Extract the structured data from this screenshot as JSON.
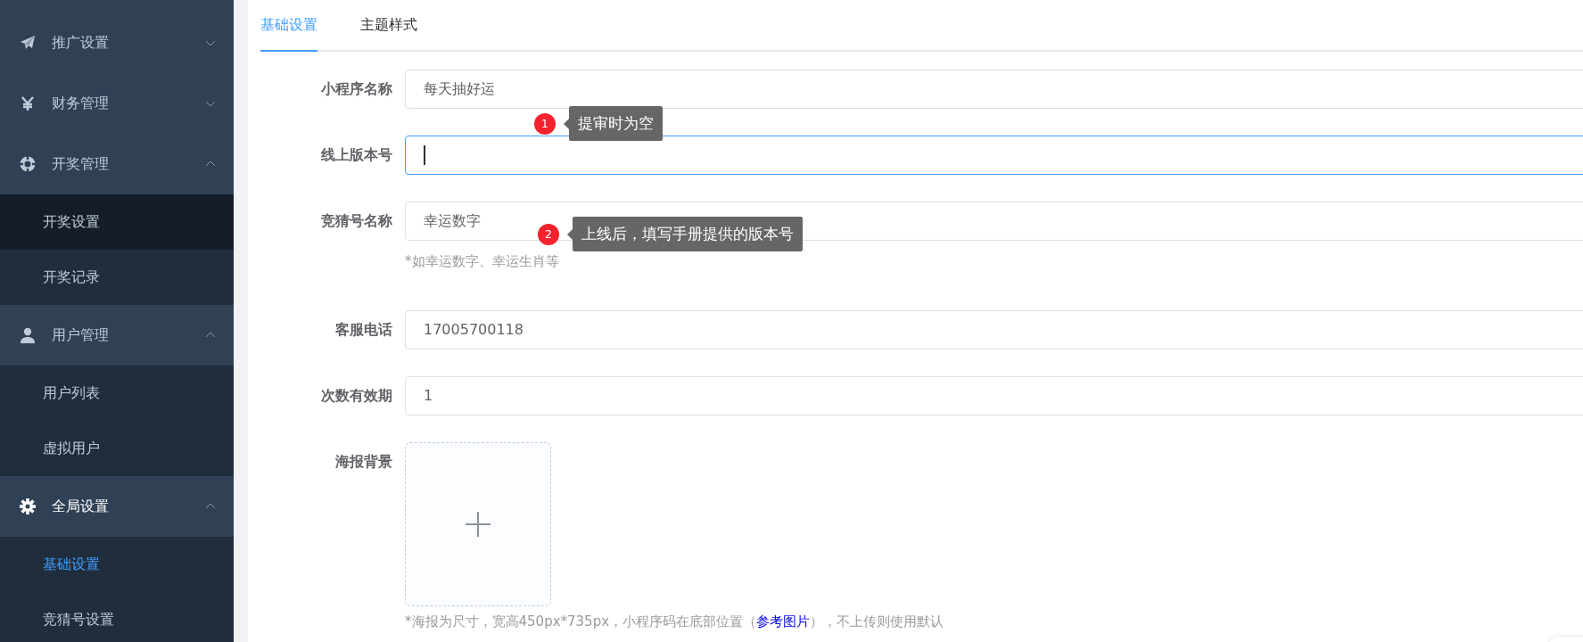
{
  "sidebar": {
    "groups": [
      {
        "label": "推广设置",
        "expanded": false
      },
      {
        "label": "财务管理",
        "expanded": false
      },
      {
        "label": "开奖管理",
        "expanded": true,
        "items": [
          {
            "label": "开奖设置",
            "selected": false,
            "hovered": true
          },
          {
            "label": "开奖记录",
            "selected": false,
            "hovered": false
          }
        ]
      },
      {
        "label": "用户管理",
        "expanded": true,
        "items": [
          {
            "label": "用户列表",
            "selected": false,
            "hovered": false
          },
          {
            "label": "虚拟用户",
            "selected": false,
            "hovered": false
          }
        ]
      },
      {
        "label": "全局设置",
        "expanded": true,
        "items": [
          {
            "label": "基础设置",
            "selected": true,
            "hovered": false
          },
          {
            "label": "竞猜号设置",
            "selected": false,
            "hovered": false
          }
        ]
      }
    ]
  },
  "tabs": [
    {
      "label": "基础设置",
      "selected": true
    },
    {
      "label": "主题样式",
      "selected": false
    }
  ],
  "form": {
    "fields": [
      {
        "kind": "text",
        "label": "小程序名称",
        "value": "每天抽好运",
        "focused": false
      },
      {
        "kind": "text",
        "label": "线上版本号",
        "focused": true
      },
      {
        "kind": "text",
        "label": "竞猜号名称",
        "value": "幸运数字",
        "focused": false,
        "hint": "*如幸运数字、幸运生肖等"
      },
      {
        "kind": "text",
        "label": "客服电话",
        "value": "17005700118",
        "focused": false
      },
      {
        "kind": "text",
        "label": "次数有效期",
        "value": "1",
        "focused": false
      },
      {
        "kind": "upload",
        "label": "海报背景",
        "hint_before": "*海报为尺寸，宽高450px*735px，小程序码在底部位置（",
        "hint_link": "参考图片",
        "hint_after": "），不上传则使用默认"
      }
    ]
  },
  "annotations": [
    {
      "number": "1",
      "text": "提审时为空"
    },
    {
      "number": "2",
      "text": "上线后，填写手册提供的版本号"
    }
  ]
}
